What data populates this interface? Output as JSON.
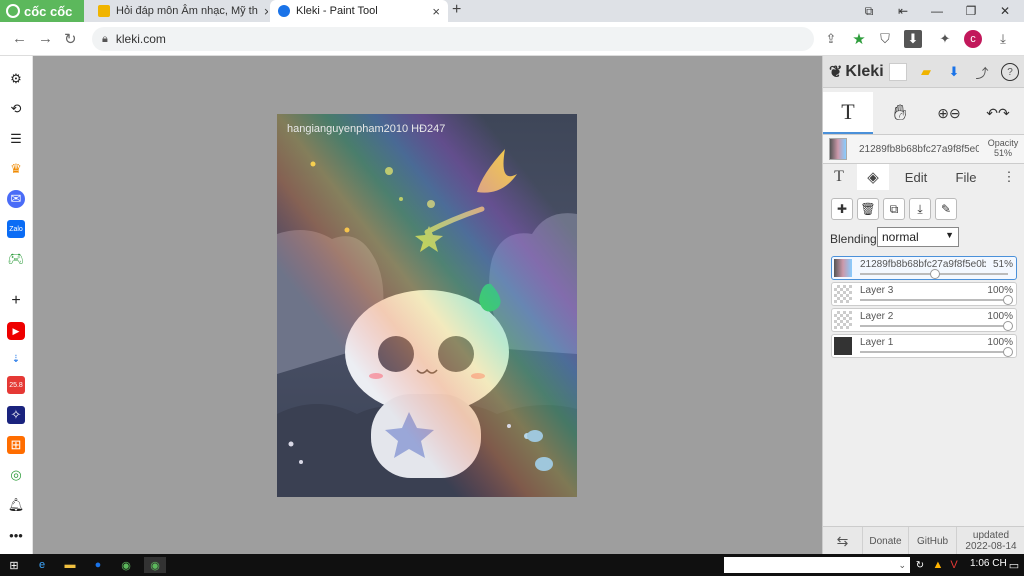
{
  "browser": {
    "brand": "cốc cốc",
    "tabs": [
      {
        "label": "Hỏi đáp môn Âm nhạc, Mỹ th",
        "active": false
      },
      {
        "label": "Kleki - Paint Tool",
        "active": true
      }
    ],
    "address": "kleki.com"
  },
  "canvas": {
    "watermark": "hangianguyenpham2010  HĐ247"
  },
  "kleki": {
    "logo": "Kleki",
    "active_layer_name": "21289fb8b68bfc27a9f8f5e0b",
    "opacity_label": "Opacity",
    "opacity_value": "51%",
    "tabs": {
      "edit": "Edit",
      "file": "File"
    },
    "blending_label": "Blending",
    "blending_value": "normal",
    "layers": [
      {
        "name": "21289fb8b68bfc27a9f8f5e0b8",
        "opacity": "51%",
        "level": 0.51,
        "selected": true
      },
      {
        "name": "Layer 3",
        "opacity": "100%",
        "level": 1.0,
        "selected": false
      },
      {
        "name": "Layer 2",
        "opacity": "100%",
        "level": 1.0,
        "selected": false
      },
      {
        "name": "Layer 1",
        "opacity": "100%",
        "level": 1.0,
        "selected": false
      }
    ],
    "footer": {
      "donate": "Donate",
      "github": "GitHub",
      "updated_label": "updated",
      "updated_date": "2022-08-14"
    }
  },
  "taskbar": {
    "time": "1:06 CH"
  }
}
